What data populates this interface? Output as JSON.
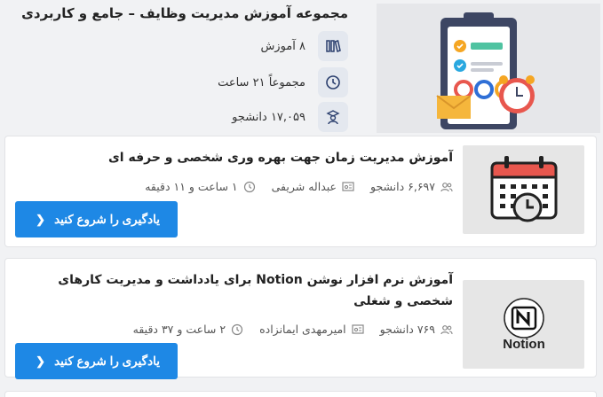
{
  "bundle": {
    "title": "مجموعه آموزش مدیریت وظایف – جامع و کاربردی",
    "meta": [
      {
        "icon": "books-icon",
        "text": "۸ آموزش"
      },
      {
        "icon": "clock-icon",
        "text": "مجموعاً ۲۱ ساعت"
      },
      {
        "icon": "student-icon",
        "text": "۱۷,۰۵۹ دانشجو"
      }
    ]
  },
  "courses": [
    {
      "title": "آموزش مدیریت زمان جهت بهره وری شخصی و حرفه ای",
      "students": "۶,۶۹۷ دانشجو",
      "teacher": "عبداله شریفی",
      "duration": "۱ ساعت و ۱۱ دقیقه",
      "cta": "یادگیری را شروع کنید",
      "thumb_icon": "calendar-clock-icon"
    },
    {
      "title": "آموزش نرم افزار نوشن Notion برای یادداشت و مدیریت کارهای شخصی و شغلی",
      "students": "۷۶۹ دانشجو",
      "teacher": "امیرمهدی ایمانزاده",
      "duration": "۲ ساعت و ۳۷ دقیقه",
      "cta": "یادگیری را شروع کنید",
      "thumb_icon": "notion-logo",
      "thumb_label": "Notion"
    }
  ],
  "colors": {
    "accent": "#1e88e5",
    "icon_bg": "#e4e8ef",
    "background": "#f1f2f4"
  }
}
